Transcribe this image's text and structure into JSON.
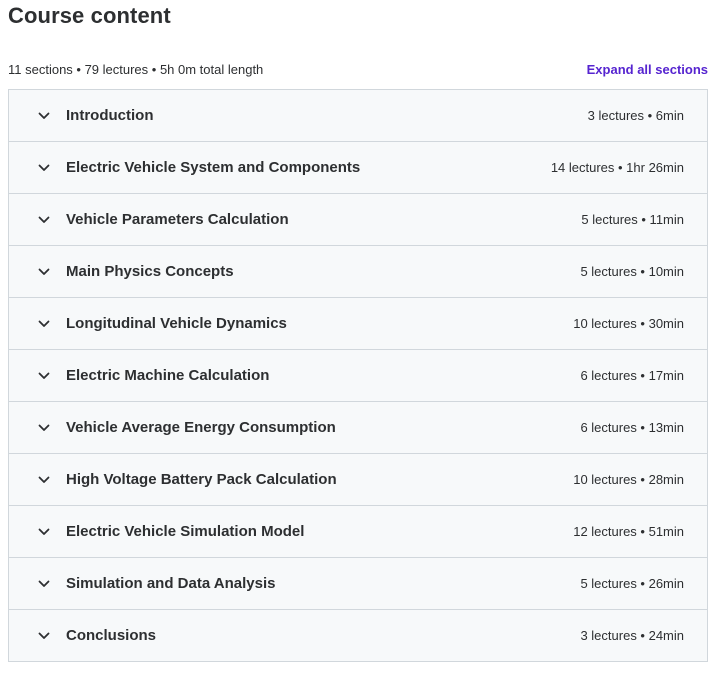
{
  "page": {
    "title": "Course content",
    "summary": "11 sections • 79 lectures • 5h 0m total length",
    "expand_label": "Expand all sections"
  },
  "colors": {
    "accent": "#5624d0",
    "row_background": "#f7f9fa",
    "border": "#d1d7dc",
    "text": "#2d2f31"
  },
  "chevron_icon": "chevron-down-icon",
  "sections": [
    {
      "title": "Introduction",
      "meta": "3 lectures • 6min"
    },
    {
      "title": "Electric Vehicle System and Components",
      "meta": "14 lectures • 1hr 26min"
    },
    {
      "title": "Vehicle Parameters Calculation",
      "meta": "5 lectures • 11min"
    },
    {
      "title": "Main Physics Concepts",
      "meta": "5 lectures • 10min"
    },
    {
      "title": "Longitudinal Vehicle Dynamics",
      "meta": "10 lectures • 30min"
    },
    {
      "title": "Electric Machine Calculation",
      "meta": "6 lectures • 17min"
    },
    {
      "title": "Vehicle Average Energy Consumption",
      "meta": "6 lectures • 13min"
    },
    {
      "title": "High Voltage Battery Pack Calculation",
      "meta": "10 lectures • 28min"
    },
    {
      "title": "Electric Vehicle Simulation Model",
      "meta": "12 lectures • 51min"
    },
    {
      "title": "Simulation and Data Analysis",
      "meta": "5 lectures • 26min"
    },
    {
      "title": "Conclusions",
      "meta": "3 lectures • 24min"
    }
  ]
}
